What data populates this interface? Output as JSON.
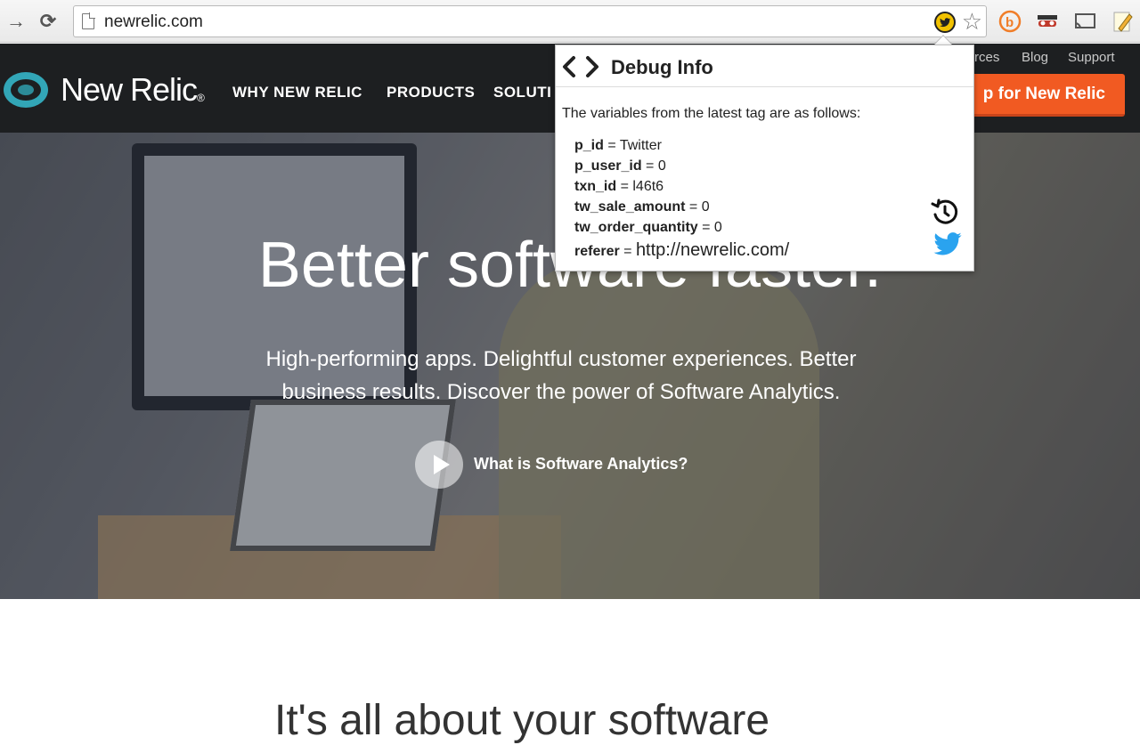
{
  "browser": {
    "url": "newrelic.com",
    "icons": [
      "forward-arrow-icon",
      "reload-icon",
      "page-icon",
      "twitter-tag-extension-icon",
      "bookmark-star-icon",
      "orange-b-extension-icon",
      "incognito-mask-icon",
      "cast-icon",
      "notes-pencil-icon"
    ]
  },
  "site": {
    "logo_text": "New Relic",
    "logo_mark": "®",
    "nav": [
      "WHY NEW RELIC",
      "PRODUCTS",
      "SOLUTI"
    ],
    "utility_links": [
      "rces",
      "Blog",
      "Support"
    ],
    "signup_label": "p for New Relic",
    "hero": {
      "title": "Better software faster.",
      "subtitle_line1": "High-performing apps. Delightful customer experiences. Better",
      "subtitle_line2": "business results. Discover the power of Software Analytics.",
      "video_label": "What is Software Analytics?"
    },
    "below_heading": "It's all about your software"
  },
  "debug_popup": {
    "title": "Debug Info",
    "intro": "The variables from the latest tag are as follows:",
    "variables": [
      {
        "key": "p_id",
        "sep": " = ",
        "value": "Twitter"
      },
      {
        "key": "p_user_id",
        "sep": " = ",
        "value": "0"
      },
      {
        "key": "txn_id",
        "sep": " = ",
        "value": "l46t6"
      },
      {
        "key": "tw_sale_amount",
        "sep": " = ",
        "value": "0"
      },
      {
        "key": "tw_order_quantity",
        "sep": " = ",
        "value": "0"
      },
      {
        "key": "referer",
        "sep": " = ",
        "value": "http://newrelic.com/"
      }
    ]
  }
}
